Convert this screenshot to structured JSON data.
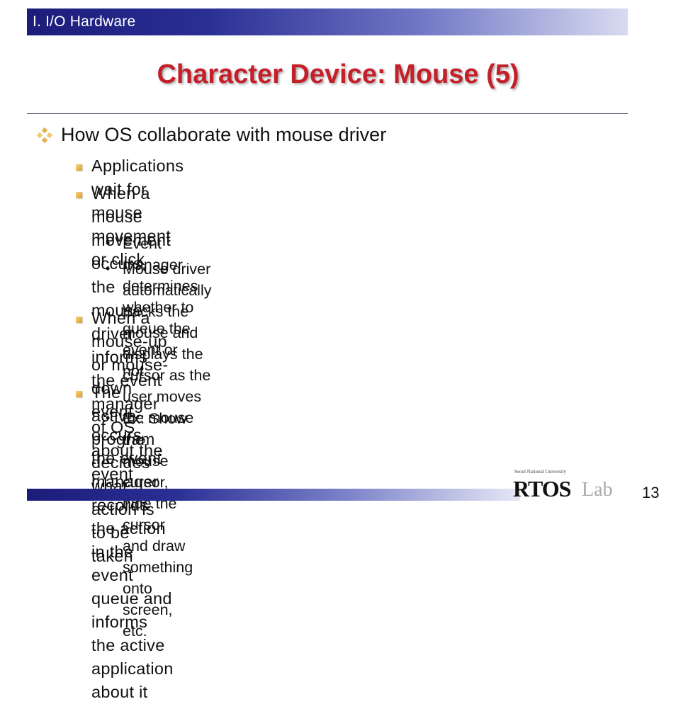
{
  "header": {
    "section": "I. I/O Hardware"
  },
  "slide": {
    "title": "Character Device: Mouse (5)"
  },
  "content": {
    "level1": "How OS collaborate with mouse driver",
    "b1": "Applications wait for mouse movement or click",
    "b2_line1": "When a mouse movement occurs, the mouse driver informs",
    "b2_line2": "the event manager of OS about the event",
    "b2_sub1": "Event manager determines whether to queue the event or not",
    "b2_sub2_line1": "Mouse driver automatically tracks the mouse and displays the",
    "b2_sub2_line2": "cursor as the user moves the mouse",
    "b3_line1": "When a mouse-up or mouse-down event occurs, the event",
    "b3_line2": "manager records the action in the event queue and informs",
    "b3_line3": "the active application about it",
    "b4": "The active program decides what action is to be taken",
    "b4_sub1_line1": "Ex: Show the mouse cursor, hide the cursor and draw",
    "b4_sub1_line2": "something onto screen, etc."
  },
  "logo": {
    "caption": "Seoul National University",
    "rtos": "RTOS",
    "lab": "Lab"
  },
  "footer": {
    "page_number": "13"
  },
  "colors": {
    "title": "#c4202a",
    "bar_dark": "#1c1c7a",
    "bullet_orange": "#e49a2a"
  }
}
